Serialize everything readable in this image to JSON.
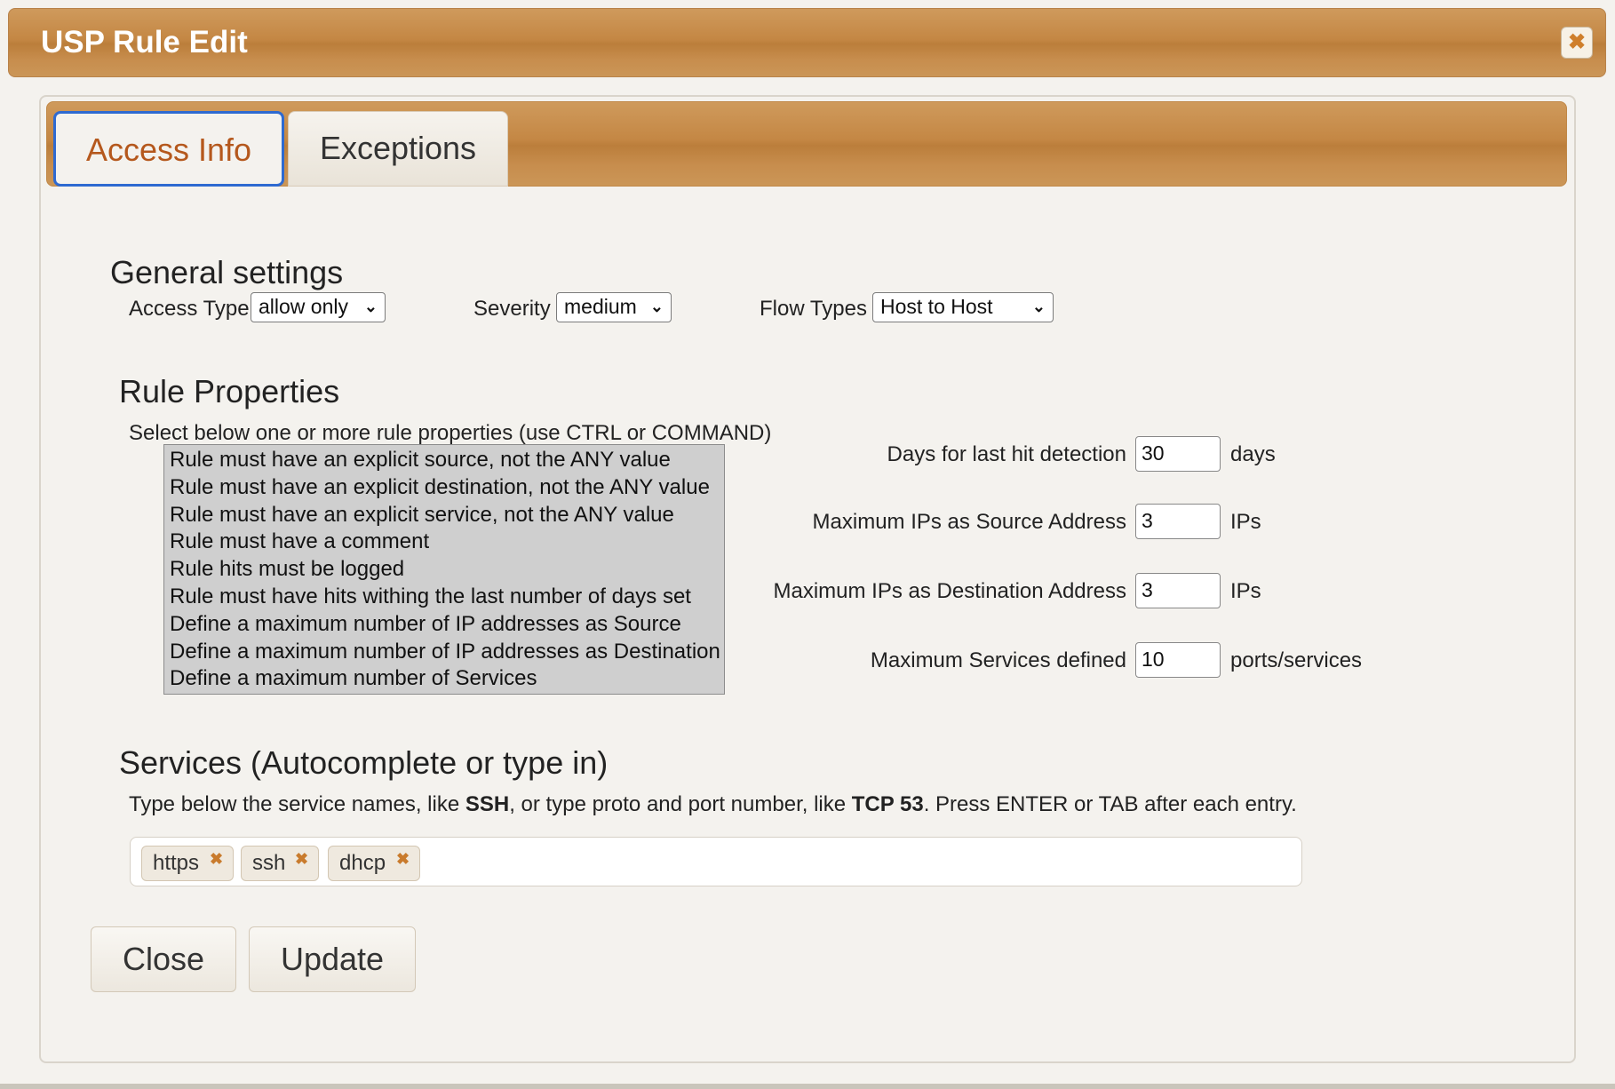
{
  "dialog": {
    "title": "USP Rule Edit"
  },
  "tabs": [
    {
      "label": "Access Info"
    },
    {
      "label": "Exceptions"
    }
  ],
  "general": {
    "heading": "General settings",
    "access_type_label": "Access Type",
    "access_type_value": "allow only",
    "severity_label": "Severity",
    "severity_value": "medium",
    "flow_types_label": "Flow Types",
    "flow_types_value": "Host to Host"
  },
  "rule_properties": {
    "heading": "Rule Properties",
    "instruction": "Select below one or more rule properties (use CTRL or COMMAND)",
    "options": [
      "Rule must have an explicit source, not the ANY value",
      "Rule must have an explicit destination, not the ANY value",
      "Rule must have an explicit service, not the ANY value",
      "Rule must have a comment",
      "Rule hits must be logged",
      "Rule must have hits withing the last number of days set",
      "Define a maximum number of IP addresses as Source",
      "Define a maximum number of IP addresses as Destination",
      "Define a maximum number of Services"
    ],
    "fields": [
      {
        "label": "Days for last hit detection",
        "value": "30",
        "unit": "days"
      },
      {
        "label": "Maximum IPs as Source Address",
        "value": "3",
        "unit": "IPs"
      },
      {
        "label": "Maximum IPs as Destination Address",
        "value": "3",
        "unit": "IPs"
      },
      {
        "label": "Maximum Services defined",
        "value": "10",
        "unit": "ports/services"
      }
    ]
  },
  "services": {
    "heading": "Services (Autocomplete or type in)",
    "hint_pre": "Type below the service names, like ",
    "hint_b1": "SSH",
    "hint_mid": ", or type proto and port number, like ",
    "hint_b2": "TCP 53",
    "hint_post": ". Press ENTER or TAB after each entry.",
    "tags": [
      "https",
      "ssh",
      "dhcp"
    ],
    "remove_glyph": "✖"
  },
  "buttons": {
    "close": "Close",
    "update": "Update"
  },
  "icons": {
    "close_dialog": "close-icon",
    "chevron": "chevron-down-icon"
  },
  "colors": {
    "accent": "#c48744",
    "tab_active_text": "#b5581d",
    "tab_focus": "#2e6ad1"
  }
}
